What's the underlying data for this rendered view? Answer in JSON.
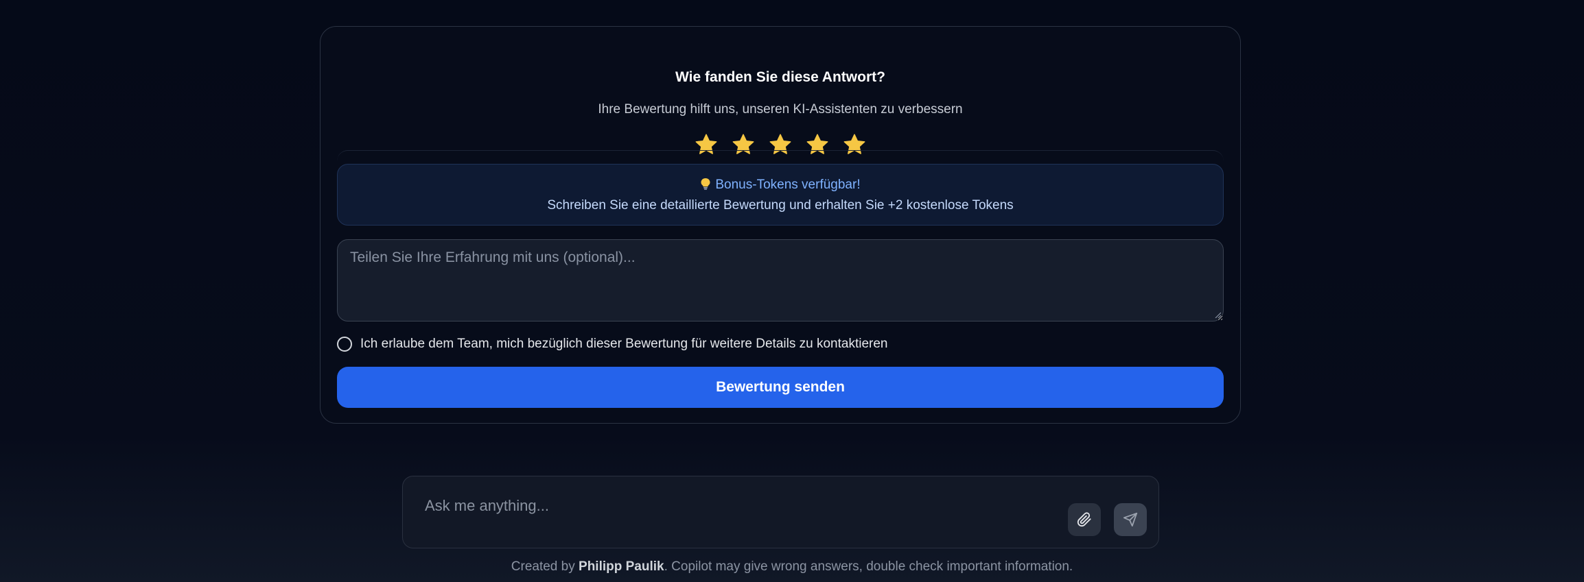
{
  "feedback": {
    "title": "Wie fanden Sie diese Antwort?",
    "subtitle": "Ihre Bewertung hilft uns, unseren KI-Assistenten zu verbessern",
    "rating": {
      "value": 5,
      "max": 5,
      "star_color": "#f6c744"
    },
    "bonus": {
      "icon": "lightbulb-icon",
      "title": "Bonus-Tokens verfügbar!",
      "text": "Schreiben Sie eine detaillierte Bewertung und erhalten Sie +2 kostenlose Tokens"
    },
    "textarea_placeholder": "Teilen Sie Ihre Erfahrung mit uns (optional)...",
    "contact_label": "Ich erlaube dem Team, mich bezüglich dieser Bewertung für weitere Details zu kontaktieren",
    "contact_checked": false,
    "submit_label": "Bewertung senden",
    "accent_color": "#2563eb"
  },
  "composer": {
    "placeholder": "Ask me anything...",
    "attach_icon": "paperclip-icon",
    "send_icon": "send-icon"
  },
  "footer": {
    "prefix": "Created by ",
    "author": "Philipp Paulik",
    "suffix": ". Copilot may give wrong answers, double check important information."
  }
}
